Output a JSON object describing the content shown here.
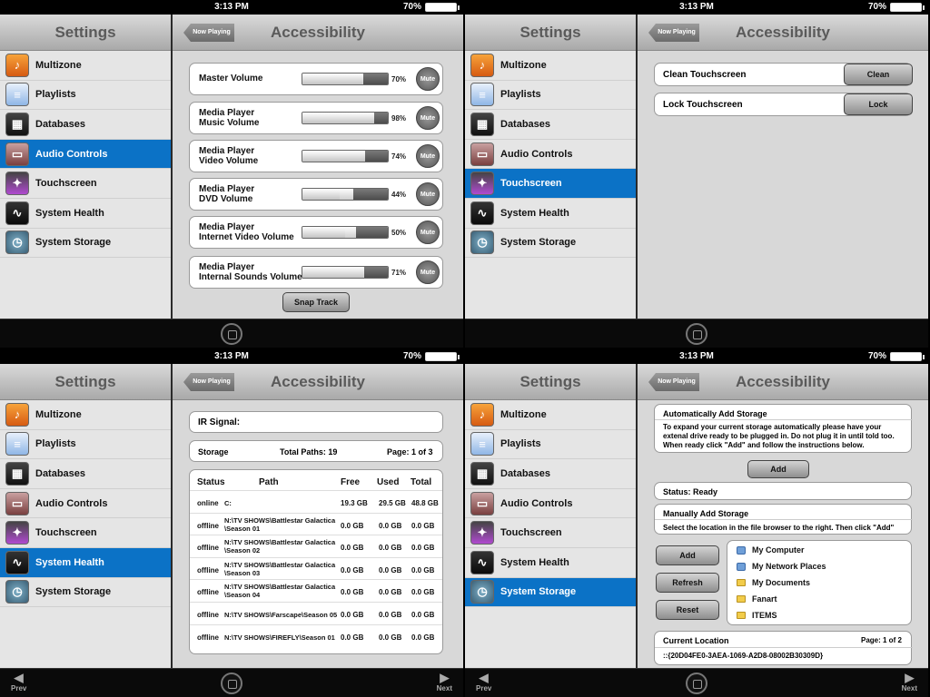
{
  "status": {
    "time": "3:13 PM",
    "battery": "70%"
  },
  "sidebar": {
    "title": "Settings",
    "items": [
      {
        "label": "Multizone",
        "icon": "multizone-icon"
      },
      {
        "label": "Playlists",
        "icon": "playlists-icon"
      },
      {
        "label": "Databases",
        "icon": "databases-icon"
      },
      {
        "label": "Audio Controls",
        "icon": "audio-controls-icon"
      },
      {
        "label": "Touchscreen",
        "icon": "touchscreen-icon"
      },
      {
        "label": "System Health",
        "icon": "system-health-icon"
      },
      {
        "label": "System Storage",
        "icon": "system-storage-icon"
      }
    ]
  },
  "header": {
    "title": "Accessibility",
    "now_playing": "Now Playing"
  },
  "nav": {
    "prev": "Prev",
    "next": "Next"
  },
  "audio": {
    "volumes": [
      {
        "label_line1": "Master Volume",
        "label_line2": "",
        "percent": "70%",
        "value": 70
      },
      {
        "label_line1": "Media Player",
        "label_line2": "Music Volume",
        "percent": "98%",
        "value": 98
      },
      {
        "label_line1": "Media Player",
        "label_line2": "Video Volume",
        "percent": "74%",
        "value": 74
      },
      {
        "label_line1": "Media Player",
        "label_line2": "DVD Volume",
        "percent": "44%",
        "value": 44
      },
      {
        "label_line1": "Media Player",
        "label_line2": "Internet Video Volume",
        "percent": "50%",
        "value": 50
      },
      {
        "label_line1": "Media Player",
        "label_line2": "Internal Sounds Volume",
        "percent": "71%",
        "value": 71
      }
    ],
    "mute_label": "Mute",
    "snap_track": "Snap Track"
  },
  "touchscreen": {
    "clean_label": "Clean Touchscreen",
    "clean_button": "Clean",
    "lock_label": "Lock Touchscreen",
    "lock_button": "Lock"
  },
  "health": {
    "ir_signal": "IR Signal:",
    "storage_label": "Storage",
    "total_paths": "Total Paths: 19",
    "page": "Page: 1 of 3",
    "columns": [
      "Status",
      "Path",
      "Free",
      "Used",
      "Total"
    ],
    "rows": [
      {
        "status": "online",
        "path1": "C:",
        "path2": "",
        "free": "19.3 GB",
        "used": "29.5 GB",
        "total": "48.8 GB"
      },
      {
        "status": "offline",
        "path1": "N:\\TV SHOWS\\Battlestar Galactica",
        "path2": "\\Season 01",
        "free": "0.0 GB",
        "used": "0.0 GB",
        "total": "0.0 GB"
      },
      {
        "status": "offline",
        "path1": "N:\\TV SHOWS\\Battlestar Galactica",
        "path2": "\\Season 02",
        "free": "0.0 GB",
        "used": "0.0 GB",
        "total": "0.0 GB"
      },
      {
        "status": "offline",
        "path1": "N:\\TV SHOWS\\Battlestar Galactica",
        "path2": "\\Season 03",
        "free": "0.0 GB",
        "used": "0.0 GB",
        "total": "0.0 GB"
      },
      {
        "status": "offline",
        "path1": "N:\\TV SHOWS\\Battlestar Galactica",
        "path2": "\\Season 04",
        "free": "0.0 GB",
        "used": "0.0 GB",
        "total": "0.0 GB"
      },
      {
        "status": "offline",
        "path1": "N:\\TV SHOWS\\Farscape\\Season 05",
        "path2": "",
        "free": "0.0 GB",
        "used": "0.0 GB",
        "total": "0.0 GB"
      },
      {
        "status": "offline",
        "path1": "N:\\TV SHOWS\\FIREFLY\\Season 01",
        "path2": "",
        "free": "0.0 GB",
        "used": "0.0 GB",
        "total": "0.0 GB"
      }
    ]
  },
  "storage": {
    "auto_title": "Automatically Add Storage",
    "auto_desc": "To expand your current storage automatically please have your extenal drive ready to be plugged in. Do not plug it in until told too. When ready click \"Add\" and follow the instructions below.",
    "add": "Add",
    "status": "Status: Ready",
    "manual_title": "Manually Add Storage",
    "manual_desc": "Select the location in the file browser to the right. Then click \"Add\"",
    "refresh": "Refresh",
    "reset": "Reset",
    "files": [
      "My Computer",
      "My Network Places",
      "My Documents",
      "Fanart",
      "ITEMS"
    ],
    "current_location_label": "Current Location",
    "page": "Page: 1 of 2",
    "location": "::{20D04FE0-3AEA-1069-A2D8-08002B30309D}"
  }
}
